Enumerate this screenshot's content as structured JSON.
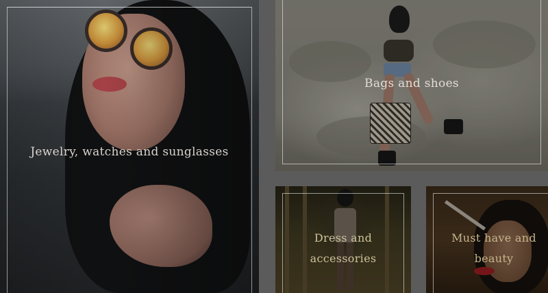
{
  "categories": [
    {
      "label": "Jewelry, watches and sunglasses"
    },
    {
      "label": "Bags and shoes"
    },
    {
      "label": "Dress and accessories"
    },
    {
      "label": "Must have and beauty"
    }
  ],
  "colors": {
    "background": "#5b5b5b",
    "label_light": "#d9d4cf",
    "label_gold": "#d8cfa6"
  }
}
